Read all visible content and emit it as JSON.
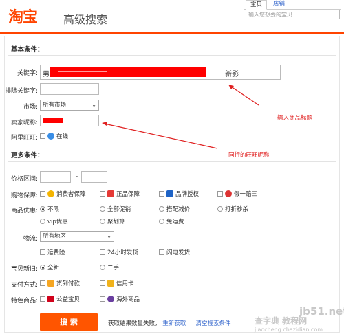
{
  "header": {
    "logo": "淘宝",
    "subtitle": "高级搜索",
    "tabs": [
      "宝贝",
      "店铺"
    ],
    "search_placeholder": "输入您想要的宝贝"
  },
  "basic": {
    "title": "基本条件：",
    "keyword_label": "关键字:",
    "keyword_value_start": "男",
    "keyword_value_end": "新影",
    "exclude_label": "排除关键字:",
    "market_label": "市场:",
    "market_value": "所有市场",
    "seller_label": "卖家昵称:",
    "wangwang_label": "阿里旺旺:",
    "online_label": "在线"
  },
  "more": {
    "title": "更多条件：",
    "price_label": "价格区间:",
    "price_sep": "-",
    "guarantee_label": "购物保障:",
    "guarantees": [
      "消费者保障",
      "正品保障",
      "品牌授权",
      "假一赔三"
    ],
    "promo_label": "商品优惠:",
    "promos_row1": [
      "不限",
      "全部促销",
      "搭配减价",
      "打折秒杀"
    ],
    "promos_row2": [
      "vip优惠",
      "聚划算",
      "免运费"
    ],
    "logistics_label": "物流:",
    "logistics_value": "所有地区",
    "logistics_opts": [
      "运费险",
      "24小时发货",
      "闪电发货"
    ],
    "condition_label": "宝贝新旧:",
    "conditions": [
      "全新",
      "二手"
    ],
    "pay_label": "支付方式:",
    "pay_opts": [
      "货到付款",
      "信用卡"
    ],
    "special_label": "特色商品:",
    "special_opts": [
      "公益宝贝",
      "海外商品"
    ]
  },
  "footer": {
    "search_button": "搜 索",
    "result_text": "获取结果数量失败，",
    "retry_link": "重新获取",
    "divider": "|",
    "clear_link": "清空搜索条件"
  },
  "annotations": {
    "title_note": "输入商品标题",
    "seller_note": "同行的旺旺昵称"
  },
  "watermark": "jb51.net",
  "watermark_sub": "查字典 教程网",
  "watermark_url": "jiaocheng.chazidian.com",
  "colors": {
    "accent": "#ff4400",
    "button": "#ff5500",
    "link": "#3366cc",
    "annotation": "#e02020"
  }
}
